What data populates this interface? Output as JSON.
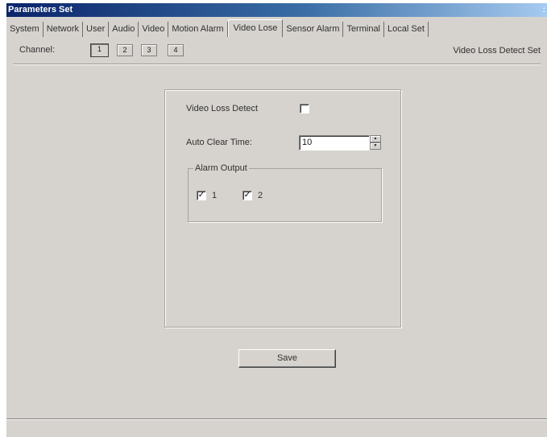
{
  "window": {
    "title": "Parameters Set"
  },
  "tabs": [
    {
      "label": "System",
      "active": false
    },
    {
      "label": "Network",
      "active": false
    },
    {
      "label": "User",
      "active": false
    },
    {
      "label": "Audio",
      "active": false
    },
    {
      "label": "Video",
      "active": false
    },
    {
      "label": "Motion Alarm",
      "active": false
    },
    {
      "label": "Video Lose",
      "active": true
    },
    {
      "label": "Sensor Alarm",
      "active": false
    },
    {
      "label": "Terminal",
      "active": false
    },
    {
      "label": "Local Set",
      "active": false
    }
  ],
  "channel": {
    "label": "Channel:",
    "buttons": [
      "1",
      "2",
      "3",
      "4"
    ],
    "selected": "1"
  },
  "section_title": "Video Loss Detect Set",
  "form": {
    "video_loss_detect_label": "Video Loss Detect",
    "video_loss_detect_checked": false,
    "auto_clear_time_label": "Auto Clear Time:",
    "auto_clear_time_value": "10",
    "alarm_output": {
      "title": "Alarm Output",
      "items": [
        {
          "label": "1",
          "checked": true
        },
        {
          "label": "2",
          "checked": true
        }
      ]
    }
  },
  "save_button": "Save"
}
